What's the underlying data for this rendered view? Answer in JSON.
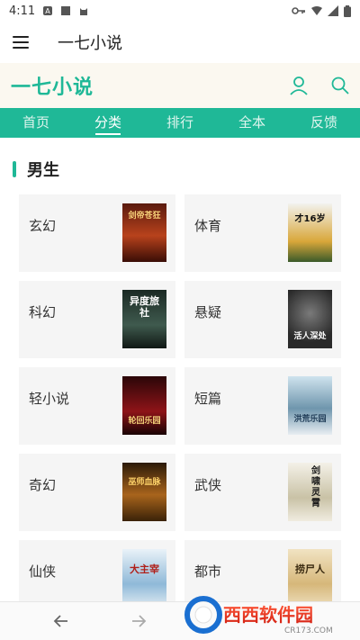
{
  "status_bar": {
    "time": "4:11"
  },
  "app_bar": {
    "title": "一七小说"
  },
  "header": {
    "logo": "一七小说"
  },
  "nav": {
    "items": [
      {
        "label": "首页"
      },
      {
        "label": "分类"
      },
      {
        "label": "排行"
      },
      {
        "label": "全本"
      },
      {
        "label": "反馈"
      }
    ],
    "active_index": 1
  },
  "section": {
    "title": "男生"
  },
  "categories": [
    {
      "label": "玄幻",
      "cover_text": "剑帝苍狂"
    },
    {
      "label": "体育",
      "cover_text": "才16岁"
    },
    {
      "label": "科幻",
      "cover_text": "异度旅社"
    },
    {
      "label": "悬疑",
      "cover_text": "活人深处"
    },
    {
      "label": "轻小说",
      "cover_text": "轮回乐园"
    },
    {
      "label": "短篇",
      "cover_text": "洪荒乐园"
    },
    {
      "label": "奇幻",
      "cover_text": "巫师血脉"
    },
    {
      "label": "武侠",
      "cover_text": "剑啸灵霄"
    },
    {
      "label": "仙侠",
      "cover_text": "大主宰"
    },
    {
      "label": "都市",
      "cover_text": "捞尸人"
    }
  ],
  "watermark": {
    "brand": "西西软件园",
    "url": "CR173.COM"
  },
  "colors": {
    "accent": "#1fb897",
    "header_bg": "#fbf8f0",
    "card_bg": "#f5f5f5"
  }
}
